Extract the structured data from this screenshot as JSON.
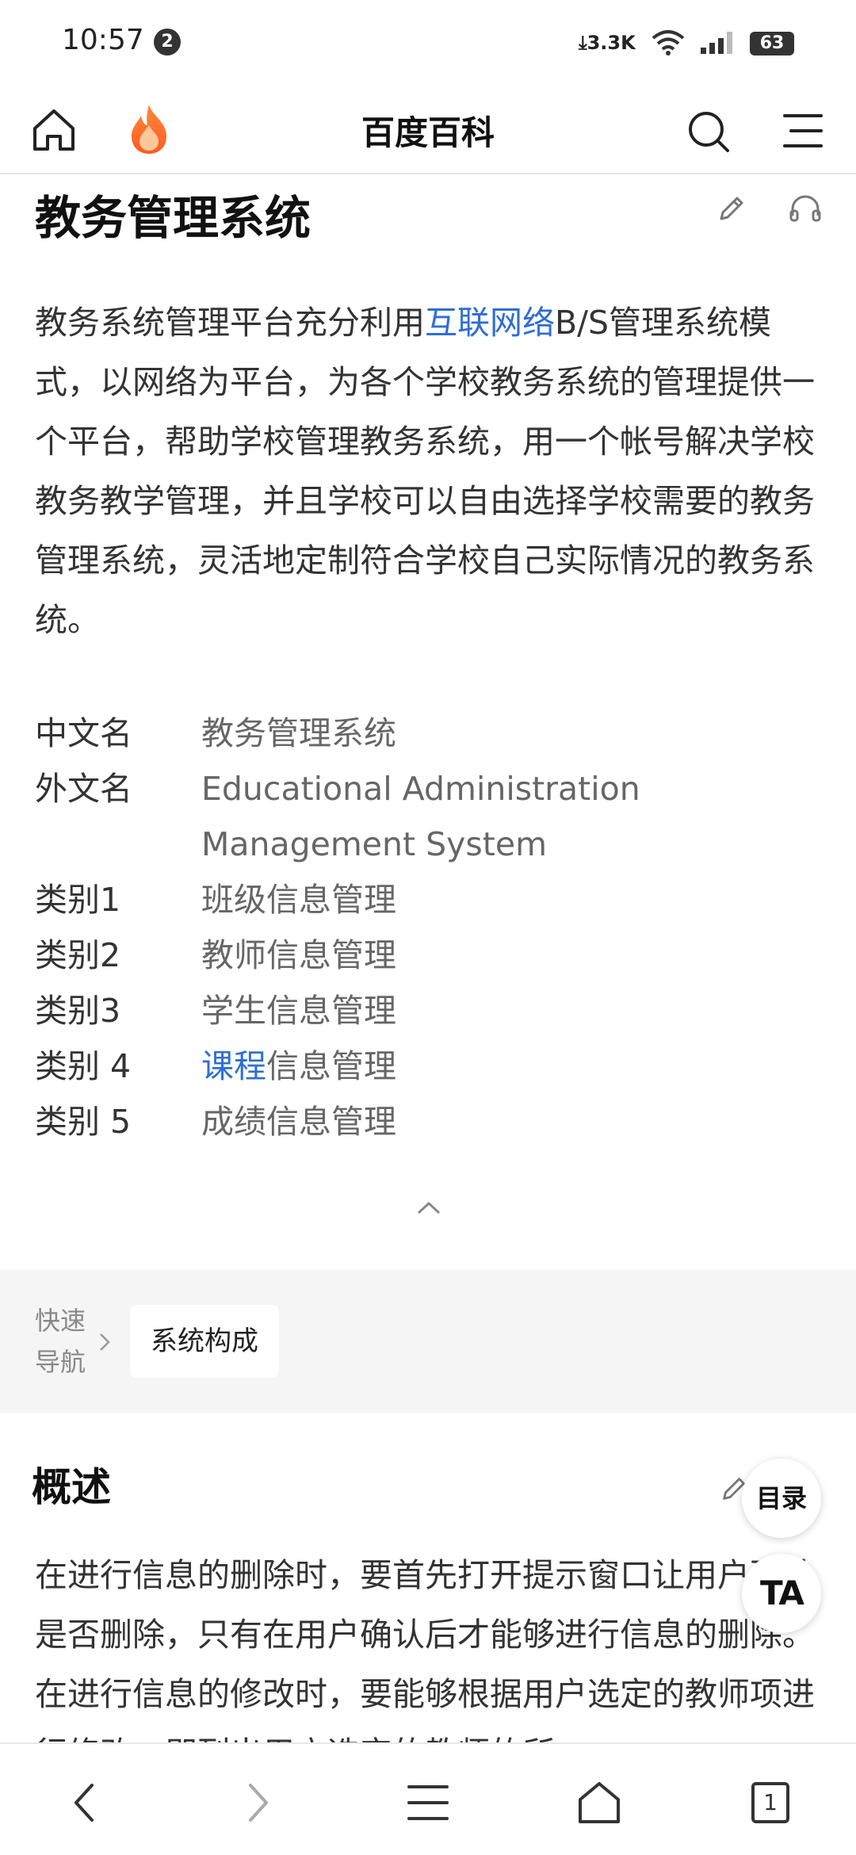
{
  "status_bar": {
    "time": "10:57",
    "notification_count": "2",
    "net_speed": "3.3K",
    "battery": "63"
  },
  "top_nav": {
    "title": "百度百科"
  },
  "article": {
    "title": "教务管理系统",
    "intro_before": "教务系统管理平台充分利用",
    "intro_link": "互联网络",
    "intro_after": "B/S管理系统模式，以网络为平台，为各个学校教务系统的管理提供一个平台，帮助学校管理教务系统，用一个帐号解决学校教务教学管理，并且学校可以自由选择学校需要的教务管理系统，灵活地定制符合学校自己实际情况的教务系统。"
  },
  "infobox": {
    "rows": [
      {
        "key": "中文名",
        "value": "教务管理系统"
      },
      {
        "key": "外文名",
        "value": "Educational Administration Management System"
      },
      {
        "key": "类别1",
        "value": "班级信息管理"
      },
      {
        "key": "类别2",
        "value": "教师信息管理"
      },
      {
        "key": "类别3",
        "value": "学生信息管理"
      },
      {
        "key": "类别 4",
        "value_link": "课程",
        "value_rest": "信息管理"
      },
      {
        "key": "类别 5",
        "value": "成绩信息管理"
      }
    ]
  },
  "quick_nav": {
    "label": "快速导航",
    "chip": "系统构成"
  },
  "section": {
    "title": "概述",
    "body": "在进行信息的删除时，要首先打开提示窗口让用户确认是否删除，只有在用户确认后才能够进行信息的删除。在进行信息的修改时，要能够根据用户选定的教师项进行修改，即列出用户选定的教师的所"
  },
  "floating": {
    "toc": "目录",
    "ta": "TA"
  },
  "bottom_nav": {
    "tab_count": "1"
  }
}
